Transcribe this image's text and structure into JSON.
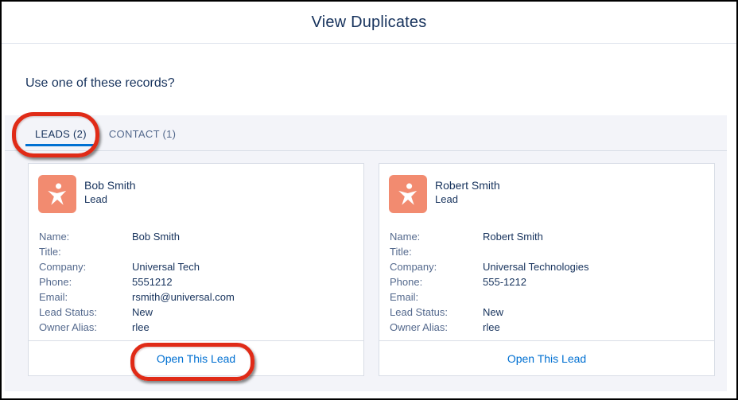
{
  "modal": {
    "title": "View Duplicates",
    "prompt": "Use one of these records?"
  },
  "tabs": {
    "leads": {
      "label": "LEADS (2)",
      "active": true
    },
    "contact": {
      "label": "CONTACT (1)",
      "active": false
    }
  },
  "field_labels": [
    "Name:",
    "Title:",
    "Company:",
    "Phone:",
    "Email:",
    "Lead Status:",
    "Owner Alias:"
  ],
  "cards": [
    {
      "title": "Bob Smith",
      "subtitle": "Lead",
      "avatar_icon": "lead-person-star-icon",
      "values": [
        "Bob Smith",
        "",
        "Universal Tech",
        "5551212",
        "rsmith@universal.com",
        "New",
        "rlee"
      ],
      "action_label": "Open This Lead"
    },
    {
      "title": "Robert Smith",
      "subtitle": "Lead",
      "avatar_icon": "lead-person-star-icon",
      "values": [
        "Robert Smith",
        "",
        "Universal Technologies",
        "555-1212",
        "",
        "New",
        "rlee"
      ],
      "action_label": "Open This Lead"
    }
  ],
  "annotations": {
    "callouts": [
      "leads-tab-callout",
      "open-this-lead-callout"
    ],
    "color": "#e02b17"
  },
  "colors": {
    "title_navy": "#16325c",
    "label_gray": "#54698d",
    "link_blue": "#0070d2",
    "tab_underline_blue": "#0070d2",
    "avatar_orange": "#f28b70",
    "panel_gray": "#f3f4f9",
    "border_gray": "#d8dde6",
    "frame_border": "#000000"
  }
}
